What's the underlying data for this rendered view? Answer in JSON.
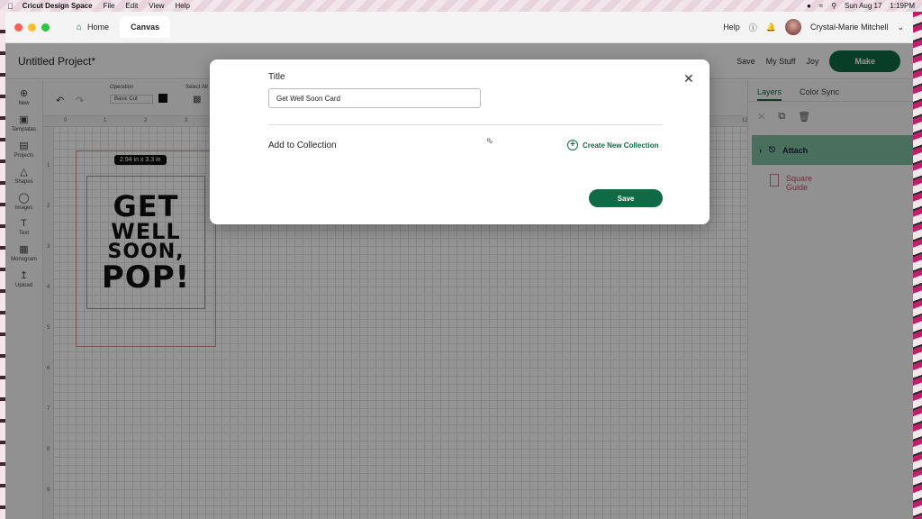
{
  "menubar": {
    "app_name": "Cricut Design Space",
    "items": [
      "File",
      "Edit",
      "View",
      "Help"
    ],
    "date": "Sun Aug 17",
    "time": "1:19PM"
  },
  "window": {
    "tabs": [
      {
        "label": "Home"
      },
      {
        "label": "Canvas"
      }
    ],
    "help_label": "Help",
    "user_name": "Crystal-Marie Mitchell"
  },
  "header": {
    "project_title": "Untitled Project*",
    "save_label": "Save",
    "my_stuff_label": "My Stuff",
    "joy_label": "Joy",
    "make_label": "Make"
  },
  "leftbar": {
    "items": [
      {
        "label": "New",
        "icon": "plus-icon"
      },
      {
        "label": "Templates",
        "icon": "shirt-icon"
      },
      {
        "label": "Projects",
        "icon": "projects-icon"
      },
      {
        "label": "Shapes",
        "icon": "shapes-icon"
      },
      {
        "label": "Images",
        "icon": "bulb-icon"
      },
      {
        "label": "Text",
        "icon": "text-icon"
      },
      {
        "label": "Monogram",
        "icon": "monogram-icon"
      },
      {
        "label": "Upload",
        "icon": "upload-icon"
      }
    ]
  },
  "toolbar": {
    "operation_label": "Operation",
    "operation_value": "Basic Cut",
    "select_all_label": "Select All"
  },
  "canvas": {
    "size_badge": "2.94  in x 3.3  in",
    "design_lines": [
      "GET",
      "WELL",
      "SOON,",
      "POP!"
    ]
  },
  "rightpanel": {
    "tabs": [
      {
        "label": "Layers"
      },
      {
        "label": "Color Sync"
      }
    ],
    "layers": [
      {
        "label": "Attach"
      },
      {
        "label": "Square Guide"
      }
    ]
  },
  "modal": {
    "title_label": "Title",
    "title_value": "Get Well Soon Card",
    "collection_label": "Add to Collection",
    "create_collection_label": "Create New Collection",
    "save_label": "Save"
  },
  "colors": {
    "accent": "#0f6b46",
    "layer_highlight": "#7fc2a4"
  }
}
